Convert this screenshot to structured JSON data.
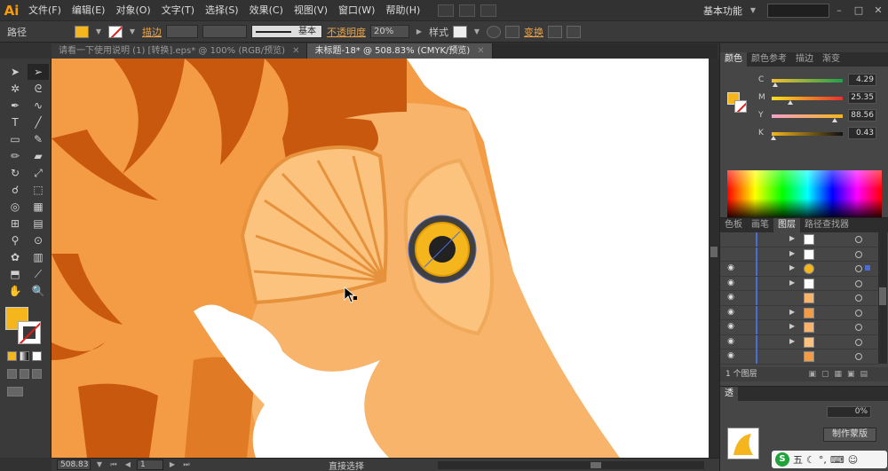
{
  "app": {
    "logo": "Ai",
    "workspace": "基本功能"
  },
  "menu": [
    "文件(F)",
    "编辑(E)",
    "对象(O)",
    "文字(T)",
    "选择(S)",
    "效果(C)",
    "视图(V)",
    "窗口(W)",
    "帮助(H)"
  ],
  "control": {
    "selection_label": "路径",
    "stroke_label": "描边",
    "brush_label": "基本",
    "opacity_label": "不透明度",
    "opacity_value": "20%",
    "style_label": "样式",
    "transform_label": "变换",
    "fill_color": "#f5b51c"
  },
  "tabs": [
    {
      "label": "请看一下使用说明 (1) [转换].eps* @ 100% (RGB/预览)",
      "active": false
    },
    {
      "label": "未标题-18* @ 508.83% (CMYK/预览)",
      "active": true
    }
  ],
  "status": {
    "zoom": "508.83",
    "page": "1",
    "tool": "直接选择"
  },
  "color_panel": {
    "tabs": [
      "颜色",
      "颜色参考",
      "描边",
      "渐变"
    ],
    "channels": [
      {
        "name": "C",
        "value": "4.29",
        "pos": 0.04
      },
      {
        "name": "M",
        "value": "25.35",
        "pos": 0.25
      },
      {
        "name": "Y",
        "value": "88.56",
        "pos": 0.89
      },
      {
        "name": "K",
        "value": "0.43",
        "pos": 0.01
      }
    ]
  },
  "layers_panel": {
    "tabs": [
      "色板",
      "画笔",
      "图层",
      "路径查找器"
    ],
    "rows": 9,
    "footer": "1 个图层"
  },
  "transparency": {
    "label": "透",
    "value": "0%",
    "mask_button": "制作蒙版"
  },
  "ime": {
    "logo": "S",
    "text": "五"
  }
}
